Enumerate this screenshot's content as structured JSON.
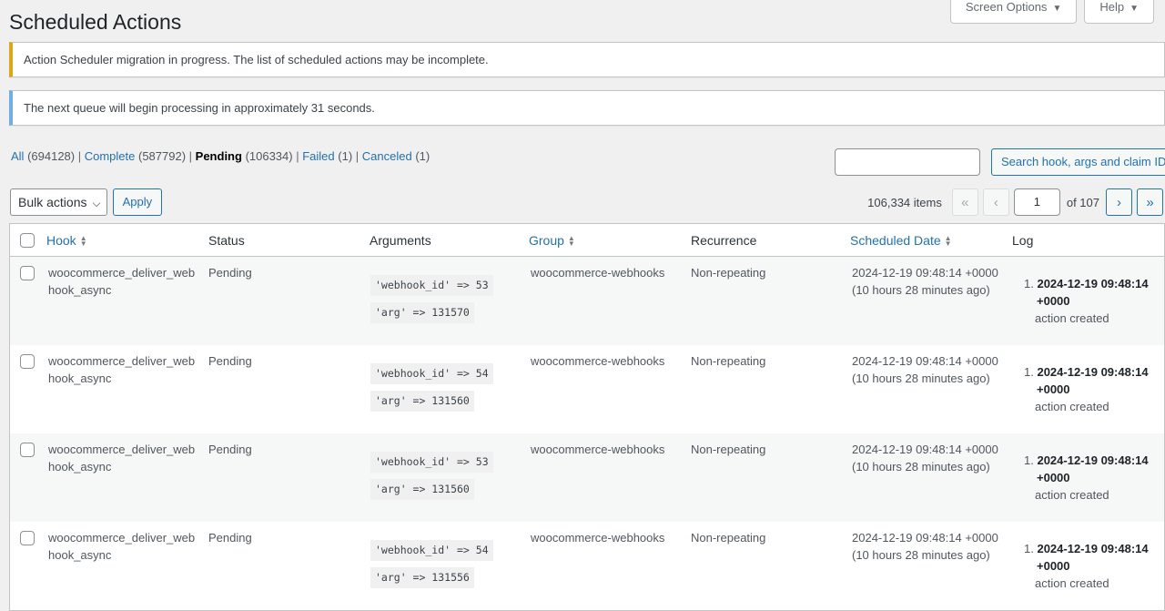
{
  "header": {
    "title": "Scheduled Actions",
    "screen_options": "Screen Options",
    "help": "Help"
  },
  "notices": {
    "warning": "Action Scheduler migration in progress. The list of scheduled actions may be incomplete.",
    "info": "The next queue will begin processing in approximately 31 seconds."
  },
  "filters": [
    {
      "label": "All",
      "count": "(694128)"
    },
    {
      "label": "Complete",
      "count": "(587792)"
    },
    {
      "label": "Pending",
      "count": "(106334)"
    },
    {
      "label": "Failed",
      "count": "(1)"
    },
    {
      "label": "Canceled",
      "count": "(1)"
    }
  ],
  "search": {
    "button": "Search hook, args and claim ID",
    "value": ""
  },
  "bulk": {
    "select": "Bulk actions",
    "apply": "Apply"
  },
  "pagination": {
    "items": "106,334 items",
    "first": "«",
    "prev": "‹",
    "next": "›",
    "last": "»",
    "current": "1",
    "of": "of 107"
  },
  "columns": {
    "hook": "Hook",
    "status": "Status",
    "arguments": "Arguments",
    "group": "Group",
    "recurrence": "Recurrence",
    "scheduled": "Scheduled Date",
    "log": "Log"
  },
  "rows": [
    {
      "hook1": "woocommerce_deliver_web",
      "hook2": "hook_async",
      "status": "Pending",
      "arg1": "'webhook_id' => 53",
      "arg2": "'arg' => 131570",
      "group": "woocommerce-webhooks",
      "recurrence": "Non-repeating",
      "date": "2024-12-19 09:48:14 +0000",
      "ago": "(10 hours 28 minutes ago)",
      "log_num": "1.",
      "log_date": "2024-12-19 09:48:14",
      "log_tz": "+0000",
      "log_msg": "action created"
    },
    {
      "hook1": "woocommerce_deliver_web",
      "hook2": "hook_async",
      "status": "Pending",
      "arg1": "'webhook_id' => 54",
      "arg2": "'arg' => 131560",
      "group": "woocommerce-webhooks",
      "recurrence": "Non-repeating",
      "date": "2024-12-19 09:48:14 +0000",
      "ago": "(10 hours 28 minutes ago)",
      "log_num": "1.",
      "log_date": "2024-12-19 09:48:14",
      "log_tz": "+0000",
      "log_msg": "action created"
    },
    {
      "hook1": "woocommerce_deliver_web",
      "hook2": "hook_async",
      "status": "Pending",
      "arg1": "'webhook_id' => 53",
      "arg2": "'arg' => 131560",
      "group": "woocommerce-webhooks",
      "recurrence": "Non-repeating",
      "date": "2024-12-19 09:48:14 +0000",
      "ago": "(10 hours 28 minutes ago)",
      "log_num": "1.",
      "log_date": "2024-12-19 09:48:14",
      "log_tz": "+0000",
      "log_msg": "action created"
    },
    {
      "hook1": "woocommerce_deliver_web",
      "hook2": "hook_async",
      "status": "Pending",
      "arg1": "'webhook_id' => 54",
      "arg2": "'arg' => 131556",
      "group": "woocommerce-webhooks",
      "recurrence": "Non-repeating",
      "date": "2024-12-19 09:48:14 +0000",
      "ago": "(10 hours 28 minutes ago)",
      "log_num": "1.",
      "log_date": "2024-12-19 09:48:14",
      "log_tz": "+0000",
      "log_msg": "action created"
    }
  ]
}
